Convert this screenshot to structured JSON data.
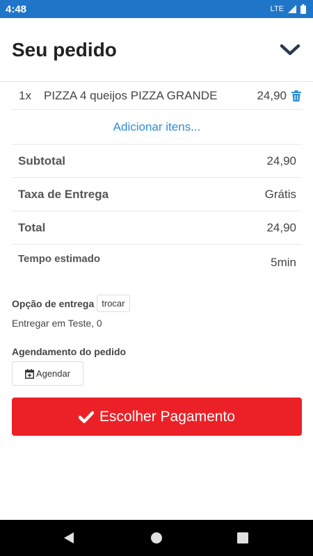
{
  "status_bar": {
    "time": "4:48",
    "network": "LTE",
    "color": "#1f76c9"
  },
  "header": {
    "title": "Seu pedido",
    "collapse_icon": "chevron-down-icon"
  },
  "cart": {
    "items": [
      {
        "qty": "1x",
        "name": "PIZZA 4 queijos PIZZA GRANDE",
        "price": "24,90",
        "delete_icon": "trash-icon"
      }
    ],
    "add_items_label": "Adicionar itens..."
  },
  "summary": {
    "subtotal_label": "Subtotal",
    "subtotal_value": "24,90",
    "delivery_fee_label": "Taxa de Entrega",
    "delivery_fee_value": "Grátis",
    "total_label": "Total",
    "total_value": "24,90",
    "eta_label": "Tempo estimado",
    "eta_value": "5min"
  },
  "delivery": {
    "label": "Opção de entrega",
    "change_button": "trocar",
    "address": "Entregar em Teste, 0"
  },
  "scheduling": {
    "label": "Agendamento do pedido",
    "button": "Agendar",
    "button_icon": "calendar-plus-icon"
  },
  "payment": {
    "button": "Escolher Pagamento",
    "button_icon": "check-icon",
    "color": "#ec2127"
  },
  "accent_link_color": "#2d8ed3"
}
